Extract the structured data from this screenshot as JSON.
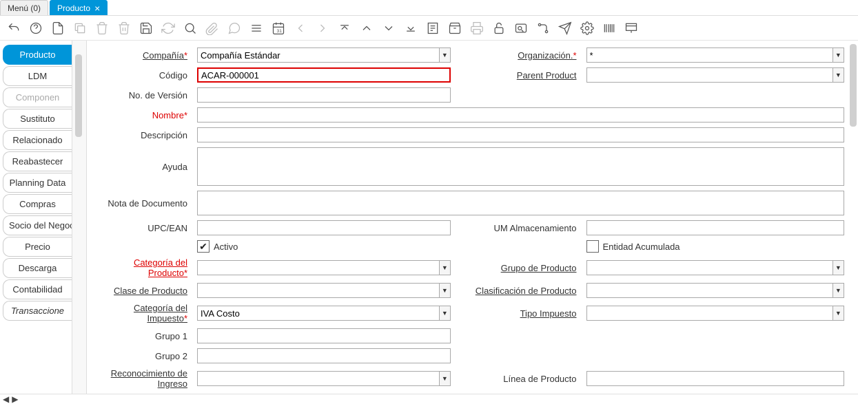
{
  "tabs": {
    "menu": "Menú (0)",
    "producto": "Producto"
  },
  "sidebar": {
    "items": [
      "Producto",
      "LDM",
      "Componen",
      "Sustituto",
      "Relacionado",
      "Reabastecer",
      "Planning Data",
      "Compras",
      "Socio del Negocio",
      "Precio",
      "Descarga",
      "Contabilidad",
      "Transaccione"
    ]
  },
  "form": {
    "compania": {
      "label": "Compañía",
      "value": "Compañía Estándar"
    },
    "organizacion": {
      "label": "Organización.",
      "value": "*"
    },
    "codigo": {
      "label": "Código",
      "value": "ACAR-000001"
    },
    "parentProduct": {
      "label": "Parent Product"
    },
    "noVersion": {
      "label": "No. de Versión"
    },
    "nombre": {
      "label": "Nombre"
    },
    "descripcion": {
      "label": "Descripción"
    },
    "ayuda": {
      "label": "Ayuda"
    },
    "notaDocumento": {
      "label": "Nota de Documento"
    },
    "upcEan": {
      "label": "UPC/EAN"
    },
    "umAlmacenamiento": {
      "label": "UM Almacenamiento"
    },
    "activo": {
      "label": "Activo"
    },
    "entidadAcumulada": {
      "label": "Entidad Acumulada"
    },
    "categoriaProducto": {
      "label": "Categoría del Producto"
    },
    "grupoProducto": {
      "label": "Grupo de Producto"
    },
    "claseProducto": {
      "label": "Clase de Producto"
    },
    "clasificacionProducto": {
      "label": "Clasificación de Producto"
    },
    "categoriaImpuesto": {
      "label": "Categoría del Impuesto",
      "value": "IVA Costo"
    },
    "tipoImpuesto": {
      "label": "Tipo Impuesto"
    },
    "grupo1": {
      "label": "Grupo 1"
    },
    "grupo2": {
      "label": "Grupo 2"
    },
    "reconocimientoIngreso": {
      "label": "Reconocimiento de Ingreso"
    },
    "lineaProducto": {
      "label": "Línea de Producto"
    }
  }
}
